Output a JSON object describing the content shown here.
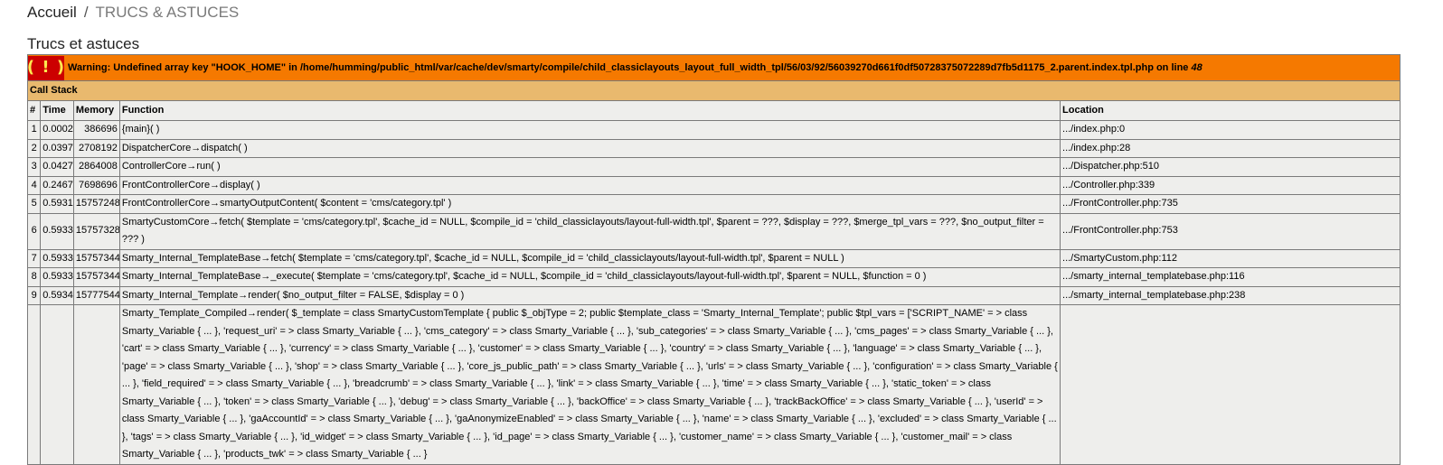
{
  "breadcrumb": {
    "home": "Accueil",
    "separator": "/",
    "current": "TRUCS & ASTUCES"
  },
  "page": {
    "title": "Trucs et astuces"
  },
  "warning": {
    "icon": "( ! )",
    "text": "Warning: Undefined array key \"HOOK_HOME\" in /home/humming/public_html/var/cache/dev/smarty/compile/child_classiclayouts_layout_full_width_tpl/56/03/92/56039270d661f0df50728375072289d7fb5d1175_2.parent.index.tpl.php on line ",
    "line": "48",
    "colors": {
      "warning_bg": "#f57900",
      "icon_bg": "#cc0000",
      "icon_fg": "#fce94f",
      "callstack_bg": "#e9b96e",
      "cell_bg": "#eeeeec"
    }
  },
  "callstack": {
    "title": "Call Stack",
    "headers": [
      "#",
      "Time",
      "Memory",
      "Function",
      "Location"
    ],
    "rows": [
      {
        "n": "1",
        "time": "0.0002",
        "memory": "386696",
        "fn": "{main}( )",
        "loc": ".../index.php:0"
      },
      {
        "n": "2",
        "time": "0.0397",
        "memory": "2708192",
        "fn": "DispatcherCore->dispatch( )",
        "loc": ".../index.php:28"
      },
      {
        "n": "3",
        "time": "0.0427",
        "memory": "2864008",
        "fn": "ControllerCore->run( )",
        "loc": ".../Dispatcher.php:510"
      },
      {
        "n": "4",
        "time": "0.2467",
        "memory": "7698696",
        "fn": "FrontControllerCore->display( )",
        "loc": ".../Controller.php:339"
      },
      {
        "n": "5",
        "time": "0.5931",
        "memory": "15757248",
        "fn": "FrontControllerCore->smartyOutputContent( $content = 'cms/category.tpl' )",
        "loc": ".../FrontController.php:735"
      },
      {
        "n": "6",
        "time": "0.5933",
        "memory": "15757328",
        "fn": "SmartyCustomCore->fetch( $template = 'cms/category.tpl', $cache_id = NULL, $compile_id = 'child_classiclayouts/layout-full-width.tpl', $parent = ???, $display = ???, $merge_tpl_vars = ???, $no_output_filter = ??? )",
        "loc": ".../FrontController.php:753"
      },
      {
        "n": "7",
        "time": "0.5933",
        "memory": "15757344",
        "fn": "Smarty_Internal_TemplateBase->fetch( $template = 'cms/category.tpl', $cache_id = NULL, $compile_id = 'child_classiclayouts/layout-full-width.tpl', $parent = NULL )",
        "loc": ".../SmartyCustom.php:112"
      },
      {
        "n": "8",
        "time": "0.5933",
        "memory": "15757344",
        "fn": "Smarty_Internal_TemplateBase->_execute( $template = 'cms/category.tpl', $cache_id = NULL, $compile_id = 'child_classiclayouts/layout-full-width.tpl', $parent = NULL, $function = 0 )",
        "loc": ".../smarty_internal_templatebase.php:116"
      },
      {
        "n": "9",
        "time": "0.5934",
        "memory": "15777544",
        "fn": "Smarty_Internal_Template->render( $no_output_filter = FALSE, $display = 0 )",
        "loc": ".../smarty_internal_templatebase.php:238"
      },
      {
        "n": "",
        "time": "",
        "memory": "",
        "fn": "Smarty_Template_Compiled->render( $_template = class SmartyCustomTemplate { public $_objType = 2; public $template_class = 'Smarty_Internal_Template'; public $tpl_vars = ['SCRIPT_NAME' => class Smarty_Variable { ... }, 'request_uri' => class Smarty_Variable { ... }, 'cms_category' => class Smarty_Variable { ... }, 'sub_categories' => class Smarty_Variable { ... }, 'cms_pages' => class Smarty_Variable { ... }, 'cart' => class Smarty_Variable { ... }, 'currency' => class Smarty_Variable { ... }, 'customer' => class Smarty_Variable { ... }, 'country' => class Smarty_Variable { ... }, 'language' => class Smarty_Variable { ... }, 'page' => class Smarty_Variable { ... }, 'shop' => class Smarty_Variable { ... }, 'core_js_public_path' => class Smarty_Variable { ... }, 'urls' => class Smarty_Variable { ... }, 'configuration' => class Smarty_Variable { ... }, 'field_required' => class Smarty_Variable { ... }, 'breadcrumb' => class Smarty_Variable { ... }, 'link' => class Smarty_Variable { ... }, 'time' => class Smarty_Variable { ... }, 'static_token' => class Smarty_Variable { ... }, 'token' => class Smarty_Variable { ... }, 'debug' => class Smarty_Variable { ... }, 'backOffice' => class Smarty_Variable { ... }, 'trackBackOffice' => class Smarty_Variable { ... }, 'userId' => class Smarty_Variable { ... }, 'gaAccountId' => class Smarty_Variable { ... }, 'gaAnonymizeEnabled' => class Smarty_Variable { ... }, 'name' => class Smarty_Variable { ... }, 'excluded' => class Smarty_Variable { ... }, 'tags' => class Smarty_Variable { ... }, 'id_widget' => class Smarty_Variable { ... }, 'id_page' => class Smarty_Variable { ... }, 'customer_name' => class Smarty_Variable { ... }, 'customer_mail' => class Smarty_Variable { ... }, 'products_twk' => class Smarty_Variable { ... }",
        "loc": ""
      }
    ]
  }
}
